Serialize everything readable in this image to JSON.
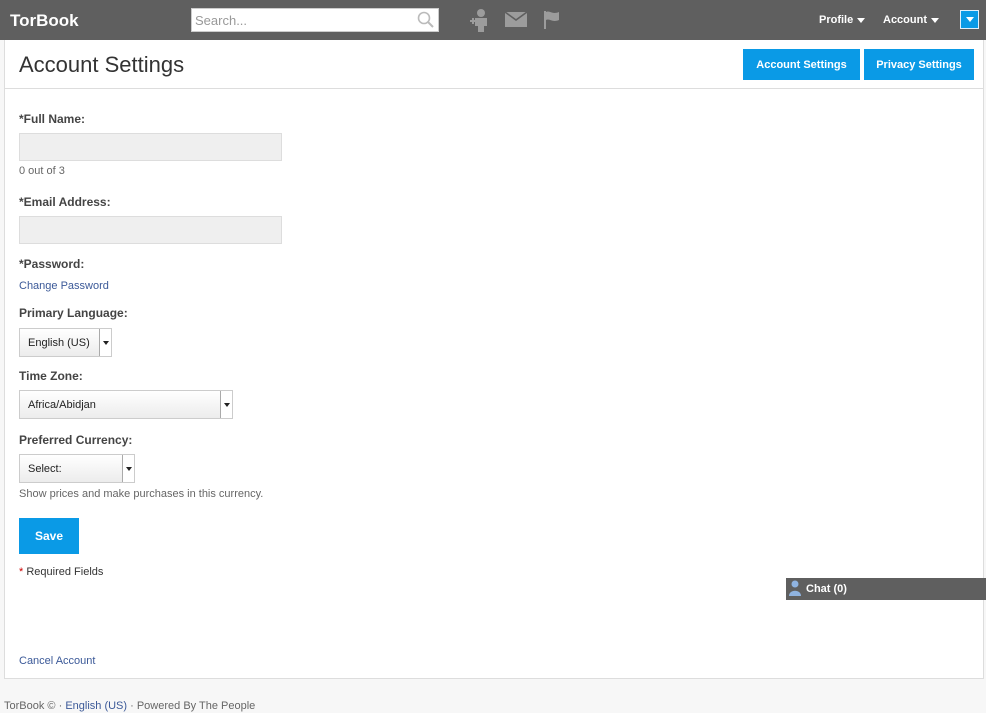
{
  "header": {
    "brand": "TorBook",
    "search_placeholder": "Search...",
    "icons": [
      "friend-requests-icon",
      "messages-icon",
      "notifications-flag-icon"
    ],
    "profile_menu": "Profile",
    "account_menu": "Account"
  },
  "page": {
    "title": "Account Settings",
    "tabs": {
      "account_settings": "Account Settings",
      "privacy_settings": "Privacy Settings"
    }
  },
  "form": {
    "full_name_label": "Full Name:",
    "full_name_value": "",
    "full_name_hint": "0 out of 3",
    "email_label": "Email Address:",
    "email_value": "",
    "password_label": "Password:",
    "change_password_link": "Change Password",
    "language_label": "Primary Language:",
    "language_value": "English (US)",
    "timezone_label": "Time Zone:",
    "timezone_value": "Africa/Abidjan",
    "currency_label": "Preferred Currency:",
    "currency_value": "Select:",
    "currency_hint": "Show prices and make purchases in this currency.",
    "save_button": "Save",
    "required_star": "*",
    "required_note": "Required Fields",
    "cancel_link": "Cancel Account"
  },
  "chat": {
    "label": "Chat (0)"
  },
  "footer": {
    "copyright": "TorBook ©",
    "sep1": "·",
    "language": "English (US)",
    "powered_by": "· Powered By The People"
  },
  "colors": {
    "accent": "#0a9ae6",
    "topbar": "#5f5f5f",
    "link": "#3b5998"
  }
}
